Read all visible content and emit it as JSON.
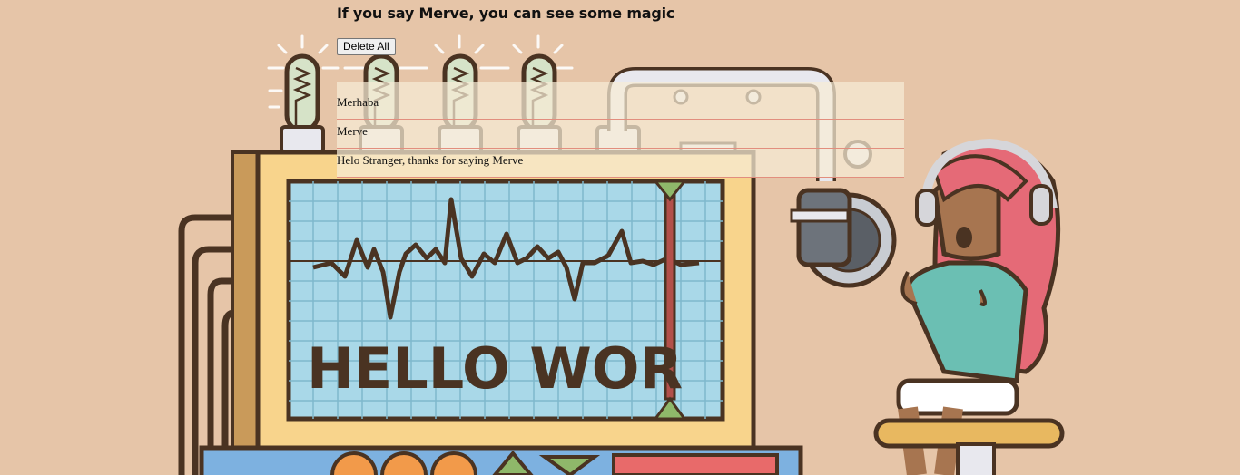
{
  "header": {
    "title": "If you say Merve, you can see some magic"
  },
  "toolbar": {
    "delete_all_label": "Delete All"
  },
  "messages": {
    "items": [
      {
        "text": "Merhaba"
      },
      {
        "text": "Merve"
      },
      {
        "text": "Helo Stranger, thanks for saying Merve"
      }
    ]
  },
  "illustration": {
    "screen_text": "HELLO WOR",
    "colors": {
      "background": "#e6c5a8",
      "outline": "#4a3322",
      "screen": "#a9d8e8",
      "frame": "#f8d48c",
      "hair": "#e56a77",
      "shirt": "#6bbfb3"
    }
  }
}
